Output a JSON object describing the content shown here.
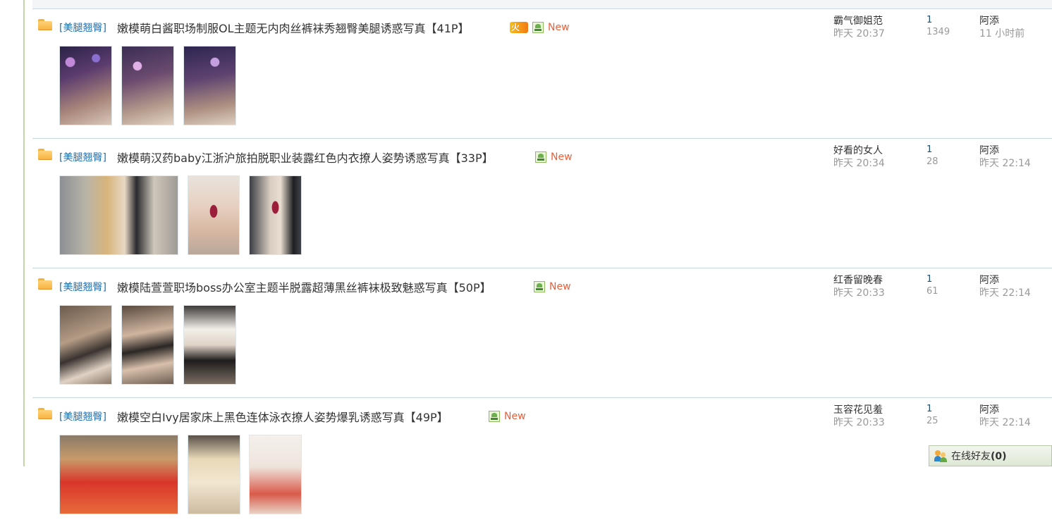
{
  "threads": [
    {
      "category": "[美腿翘臀]",
      "title": "嫩模萌白酱职场制服OL主题无内肉丝裤袜秀翘臀美腿诱惑写真【41P】",
      "hot": true,
      "new_label": "New",
      "author": "霸气御姐范",
      "author_time": "昨天 20:37",
      "replies": "1",
      "views": "1349",
      "last_user": "阿添",
      "last_time": "11 小时前"
    },
    {
      "category": "[美腿翘臀]",
      "title": "嫩模萌汉药baby江浙沪旅拍脱职业装露红色内衣撩人姿势诱惑写真【33P】",
      "hot": false,
      "new_label": "New",
      "author": "好看的女人",
      "author_time": "昨天 20:34",
      "replies": "1",
      "views": "28",
      "last_user": "阿添",
      "last_time": "昨天 22:14"
    },
    {
      "category": "[美腿翘臀]",
      "title": "嫩模陆萱萱职场boss办公室主题半脱露超薄黑丝裤袜极致魅惑写真【50P】",
      "hot": false,
      "new_label": "New",
      "author": "红香留晚春",
      "author_time": "昨天 20:33",
      "replies": "1",
      "views": "61",
      "last_user": "阿添",
      "last_time": "昨天 22:14"
    },
    {
      "category": "[美腿翘臀]",
      "title": "嫩模空白Ivy居家床上黑色连体泳衣撩人姿势爆乳诱惑写真【49P】",
      "hot": false,
      "new_label": "New",
      "author": "玉容花见羞",
      "author_time": "昨天 20:33",
      "replies": "1",
      "views": "25",
      "last_user": "阿添",
      "last_time": "昨天 22:14"
    }
  ],
  "online_friends": {
    "label": "在线好友",
    "count": "(0)"
  },
  "colors": {
    "category_link": "#1e6fb4",
    "new_badge": "#e8613c",
    "muted_text": "#999999",
    "row_divider": "#c9d8e2"
  }
}
